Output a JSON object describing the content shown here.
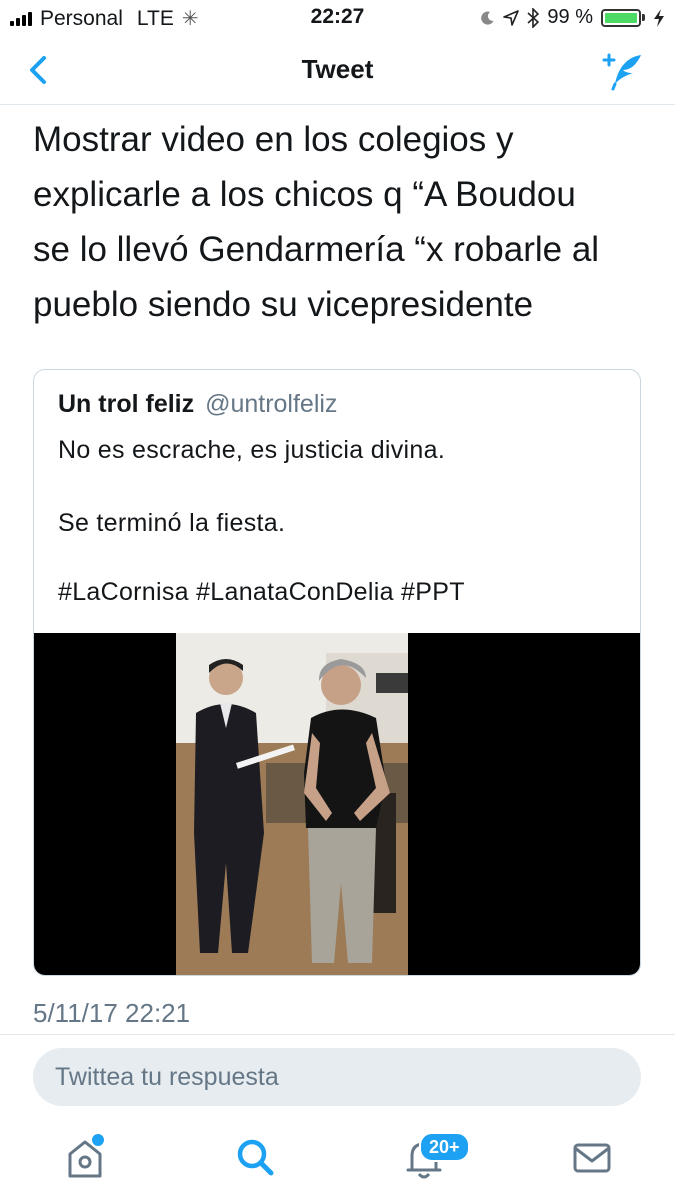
{
  "status_bar": {
    "carrier": "Personal",
    "network": "LTE",
    "time": "22:27",
    "battery": "99 %",
    "battery_level": 0.99
  },
  "nav": {
    "title": "Tweet"
  },
  "tweet": {
    "text_lines": [
      "Mostrar video en los colegios y",
      "explicarle a los chicos q “A Boudou",
      "se lo llevó Gendarmería “x robarle al",
      "pueblo siendo su vicepresidente"
    ],
    "timestamp": "5/11/17 22:21"
  },
  "quoted_tweet": {
    "name": "Un trol feliz",
    "handle": "@untrolfeliz",
    "line1": "No es escrache, es justicia divina.",
    "line2": "Se terminó la fiesta.",
    "line3": "#LaCornisa #LanataConDelia  #PPT"
  },
  "reply": {
    "placeholder": "Twittea tu respuesta"
  },
  "tab_bar": {
    "notifications_badge": "20+"
  },
  "colors": {
    "accent": "#1da1f2",
    "text": "#14171a",
    "secondary": "#657786"
  }
}
